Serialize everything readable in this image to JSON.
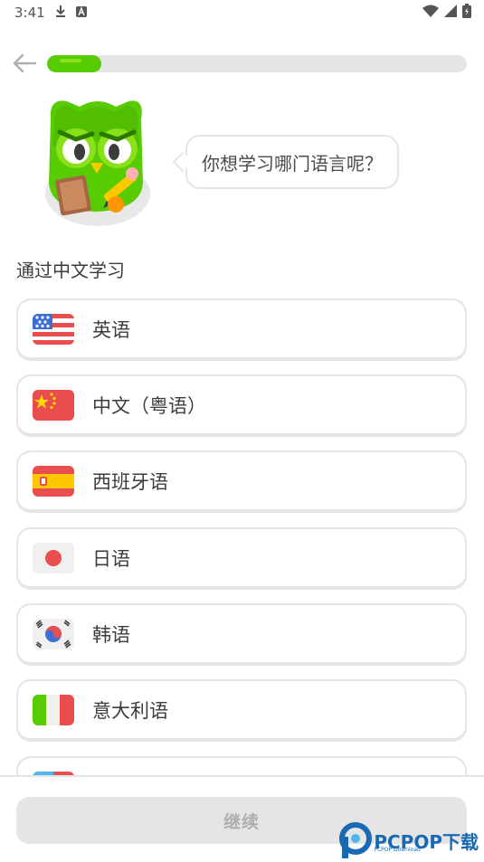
{
  "status_bar": {
    "time": "3:41"
  },
  "progress": {
    "fraction": 0.13
  },
  "speech_bubble": {
    "text": "你想学习哪门语言呢？"
  },
  "section": {
    "title": "通过中文学习"
  },
  "languages": [
    {
      "label": "英语",
      "flag": "usa"
    },
    {
      "label": "中文（粤语）",
      "flag": "china"
    },
    {
      "label": "西班牙语",
      "flag": "spain"
    },
    {
      "label": "日语",
      "flag": "japan"
    },
    {
      "label": "韩语",
      "flag": "korea"
    },
    {
      "label": "意大利语",
      "flag": "italy"
    },
    {
      "label": "",
      "flag": "partial"
    }
  ],
  "footer": {
    "continue_label": "继续"
  },
  "watermark": {
    "brand": "PCPOP下载",
    "sub": "PCPOP Download"
  },
  "colors": {
    "accent": "#58cc02",
    "border": "#e5e5e5",
    "disabled": "#afafaf"
  }
}
